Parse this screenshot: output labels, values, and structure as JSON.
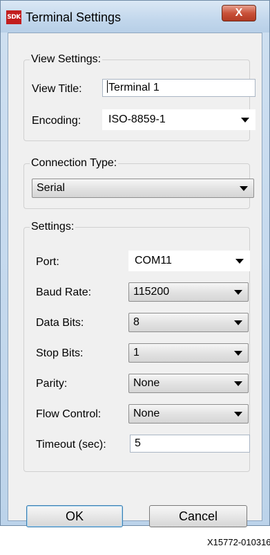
{
  "window": {
    "title": "Terminal Settings",
    "icon_label": "SDK",
    "close_label": "X"
  },
  "view_settings": {
    "group_label": "View Settings:",
    "view_title_label": "View Title:",
    "view_title_value": "Terminal 1",
    "encoding_label": "Encoding:",
    "encoding_value": "ISO-8859-1"
  },
  "connection_type": {
    "group_label": "Connection Type:",
    "value": "Serial"
  },
  "settings": {
    "group_label": "Settings:",
    "port_label": "Port:",
    "port_value": "COM11",
    "baud_label": "Baud Rate:",
    "baud_value": "115200",
    "data_bits_label": "Data Bits:",
    "data_bits_value": "8",
    "stop_bits_label": "Stop Bits:",
    "stop_bits_value": "1",
    "parity_label": "Parity:",
    "parity_value": "None",
    "flow_label": "Flow Control:",
    "flow_value": "None",
    "timeout_label": "Timeout (sec):",
    "timeout_value": "5"
  },
  "buttons": {
    "ok": "OK",
    "cancel": "Cancel"
  },
  "footer_code": "X15772-010316"
}
